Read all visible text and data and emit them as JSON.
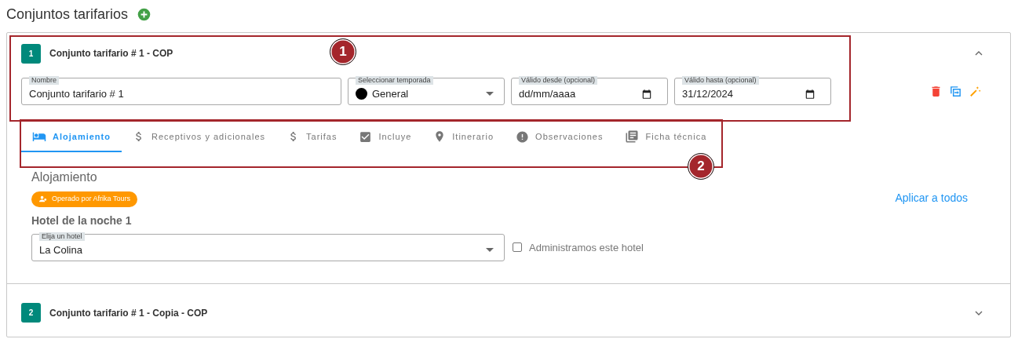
{
  "page": {
    "title": "Conjuntos tarifarios"
  },
  "rate_sets": [
    {
      "number": "1",
      "title": "Conjunto tarifario # 1 - COP",
      "expanded": true,
      "fields": [
        {
          "kind": "text",
          "label": "Nombre",
          "value": "Conjunto tarifario # 1"
        },
        {
          "kind": "select",
          "label": "Seleccionar temporada",
          "value": "General",
          "color": "#000000"
        },
        {
          "kind": "date",
          "label": "Válido desde (opcional)",
          "placeholder": "dd/mm/aaaa"
        },
        {
          "kind": "date",
          "label": "Válido hasta (opcional)",
          "value": "31/12/2024"
        }
      ],
      "tabs": [
        {
          "label": "Alojamiento",
          "selected": true
        },
        {
          "label": "Receptivos y adicionales",
          "selected": false
        },
        {
          "label": "Tarifas",
          "selected": false
        },
        {
          "label": "Incluye",
          "selected": false
        },
        {
          "label": "Itinerario",
          "selected": false
        },
        {
          "label": "Observaciones",
          "selected": false
        },
        {
          "label": "Ficha técnica",
          "selected": false
        }
      ],
      "section": {
        "title": "Alojamiento",
        "operator_badge": "Operado por Afrika Tours",
        "apply_all_link": "Aplicar a todos",
        "night_title": "Hotel de la noche 1",
        "hotel_field": {
          "label": "Elija un hotel",
          "value": "La Colina"
        },
        "managed_checkbox": {
          "label": "Administramos este hotel",
          "checked": false
        }
      }
    },
    {
      "number": "2",
      "title": "Conjunto tarifario # 1 - Copia - COP",
      "expanded": false
    }
  ],
  "annotations": [
    {
      "label": "1"
    },
    {
      "label": "2"
    }
  ]
}
